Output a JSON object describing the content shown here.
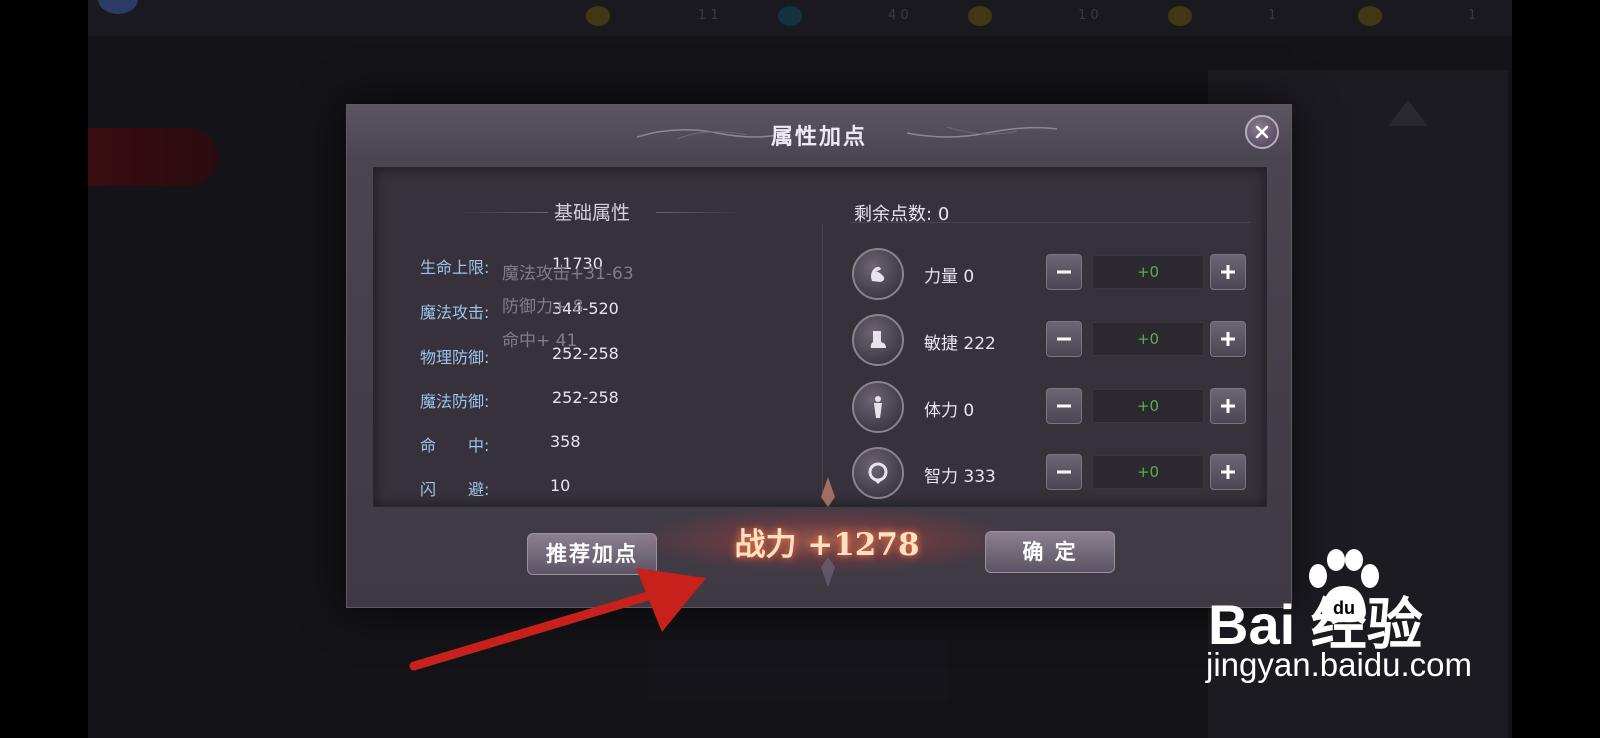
{
  "background": {
    "top_stats": [
      "1 1",
      "4 0",
      "1 0",
      "1",
      "1"
    ]
  },
  "dialog": {
    "title": "属性加点",
    "close_label": "✕",
    "basic": {
      "title": "基础属性",
      "attributes": [
        {
          "label": "生命上限:",
          "value": "11730"
        },
        {
          "label": "魔法攻击:",
          "value": "344-520"
        },
        {
          "label": "物理防御:",
          "value": "252-258"
        },
        {
          "label": "魔法防御:",
          "value": "252-258"
        },
        {
          "label": "命　　中:",
          "value": "358"
        },
        {
          "label": "闪　　避:",
          "value": "10"
        }
      ],
      "tooltip": [
        "魔法攻击+31-63",
        "防御力+ 8",
        "命中+ 41"
      ]
    },
    "allocation": {
      "remaining_label": "剩余点数:",
      "remaining_value": "0",
      "stats": [
        {
          "name": "力量 0",
          "icon": "strength-icon",
          "value": "+0"
        },
        {
          "name": "敏捷 222",
          "icon": "agility-icon",
          "value": "+0"
        },
        {
          "name": "体力 0",
          "icon": "stamina-icon",
          "value": "+0"
        },
        {
          "name": "智力 333",
          "icon": "intellect-icon",
          "value": "+0"
        }
      ],
      "minus_label": "−",
      "plus_label": "+"
    },
    "recommend_button": "推荐加点",
    "confirm_button": "确 定",
    "power_text": "战力 +1278"
  },
  "watermark": {
    "logo": "Bai  经验",
    "url": "jingyan.baidu.com"
  },
  "colors": {
    "accent_blue": "#9cc4ec",
    "increase_green": "#58b048",
    "arrow_red": "#c8201a"
  }
}
